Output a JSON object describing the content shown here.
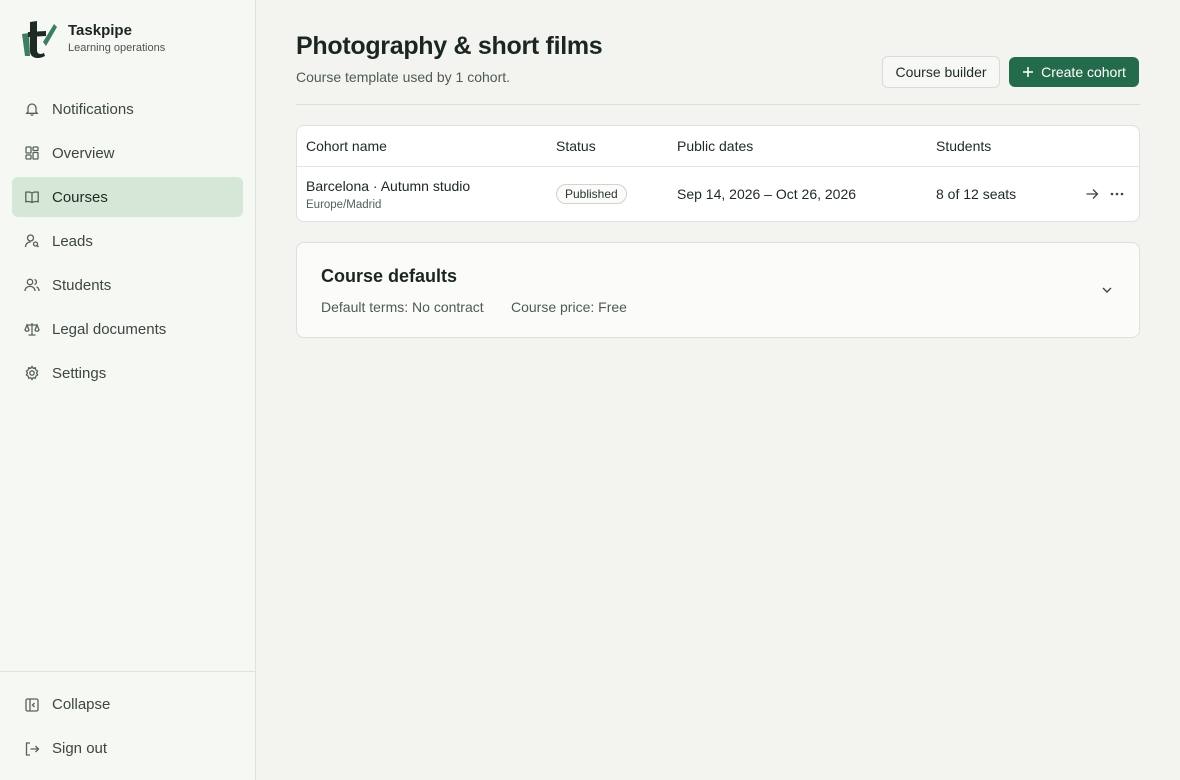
{
  "brand": {
    "name": "Taskpipe",
    "subtitle": "Learning operations"
  },
  "nav": [
    {
      "label": "Notifications",
      "icon": "bell-icon"
    },
    {
      "label": "Overview",
      "icon": "grid-icon"
    },
    {
      "label": "Courses",
      "icon": "book-icon",
      "active": true
    },
    {
      "label": "Leads",
      "icon": "user-search-icon"
    },
    {
      "label": "Students",
      "icon": "users-icon"
    },
    {
      "label": "Legal documents",
      "icon": "scale-icon"
    },
    {
      "label": "Settings",
      "icon": "gear-icon"
    }
  ],
  "sidebar_bottom": {
    "collapse": "Collapse",
    "sign_out": "Sign out"
  },
  "page": {
    "title": "Photography & short films",
    "subtitle": "Course template used by 1 cohort.",
    "course_builder_label": "Course builder",
    "create_cohort_label": "Create cohort"
  },
  "table": {
    "headers": {
      "name": "Cohort name",
      "status": "Status",
      "dates": "Public dates",
      "students": "Students"
    },
    "rows": [
      {
        "name": "Barcelona · Autumn studio",
        "timezone": "Europe/Madrid",
        "status": "Published",
        "dates": "Sep 14, 2026 – Oct 26, 2026",
        "students": "8 of 12 seats"
      }
    ]
  },
  "defaults": {
    "title": "Course defaults",
    "terms": "Default terms: No contract",
    "price": "Course price: Free"
  },
  "colors": {
    "primary": "#246b4c",
    "active_nav": "#d5e8d8",
    "sidebar_bg": "#f6f8f3"
  }
}
